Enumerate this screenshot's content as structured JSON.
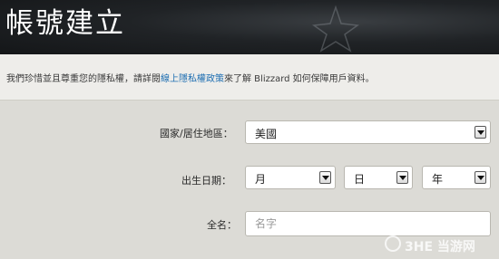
{
  "header": {
    "title": "帳號建立"
  },
  "notice": {
    "text_before": "我們珍惜並且尊重您的隱私權，請詳閱",
    "link_text": "線上隱私權政策",
    "text_after": "來了解 Blizzard 如何保障用戶資料。"
  },
  "form": {
    "country": {
      "label": "國家/居住地區：",
      "value": "美國"
    },
    "birthdate": {
      "label": "出生日期：",
      "month": "月",
      "day": "日",
      "year": "年"
    },
    "fullname": {
      "label": "全名：",
      "placeholder": "名字"
    }
  },
  "watermark": {
    "text": "3HE 当游网"
  }
}
